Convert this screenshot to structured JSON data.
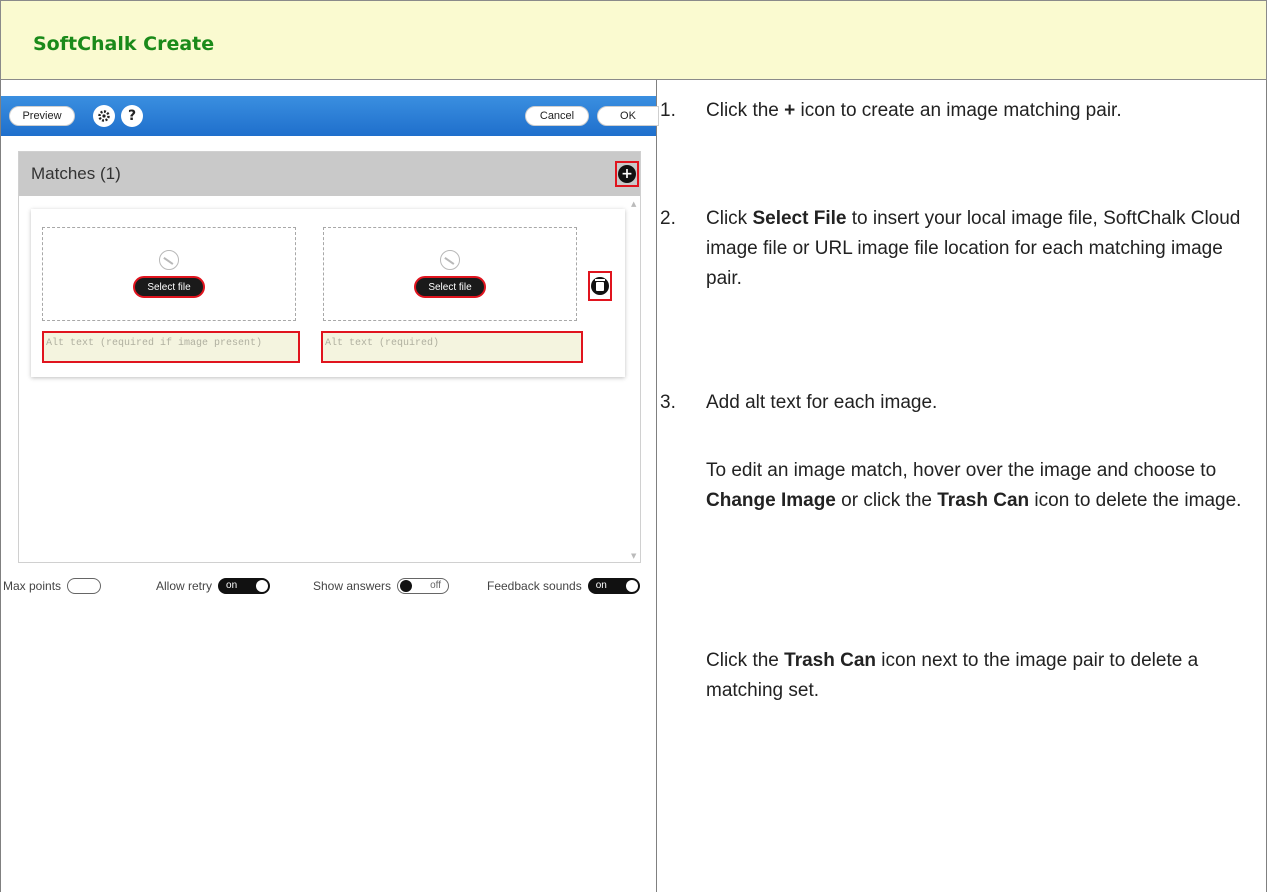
{
  "doc": {
    "title": "SoftChalk Create"
  },
  "toolbar": {
    "preview_label": "Preview",
    "gear_icon": "gear-icon",
    "help_label": "?",
    "cancel_label": "Cancel",
    "ok_label": "OK",
    "accent_color": "#2a7fd6"
  },
  "matches": {
    "title": "Matches (1)",
    "add_label": "+",
    "pair": {
      "left": {
        "select_label": "Select file",
        "alt_placeholder": "Alt text (required if image present)"
      },
      "right": {
        "select_label": "Select file",
        "alt_placeholder": "Alt text (required)"
      }
    },
    "highlight_color": "#e0141e"
  },
  "settings": {
    "max_points": {
      "label": "Max points"
    },
    "allow_retry": {
      "label": "Allow retry",
      "state": "on"
    },
    "show_answers": {
      "label": "Show answers",
      "state": "off"
    },
    "feedback_sounds": {
      "label": "Feedback sounds",
      "state": "on"
    }
  },
  "instructions": {
    "step1": {
      "num": "1.",
      "pre": "Click the ",
      "bold": "+",
      "post": " icon to create an image matching pair."
    },
    "step2": {
      "num": "2.",
      "pre": "Click ",
      "bold": "Select File",
      "post": " to insert your local image file, SoftChalk Cloud image file or URL image file location for each matching image pair."
    },
    "step3": {
      "num": "3.",
      "text": "Add alt text for each image."
    },
    "note1": {
      "pre": "To edit an image match, hover over the image and choose to ",
      "bold1": "Change Image",
      "mid": " or click the ",
      "bold2": "Trash Can",
      "post": " icon to delete the image."
    },
    "note2": {
      "pre": "Click the ",
      "bold": "Trash Can",
      "post": " icon next to the image pair to delete a matching set."
    }
  }
}
